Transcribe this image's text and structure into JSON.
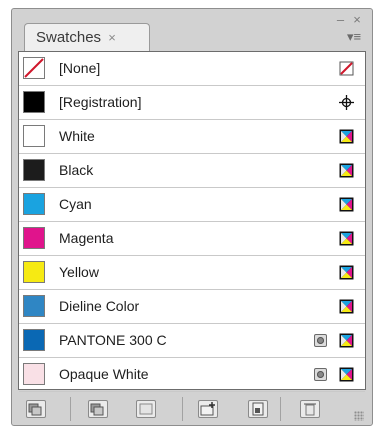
{
  "panel": {
    "tab_label": "Swatches",
    "tab_close_glyph": "×",
    "window_minimize_glyph": "–",
    "window_close_glyph": "×",
    "panel_menu_glyph": "▾≡"
  },
  "swatches": [
    {
      "name": "[None]",
      "color": "none",
      "type_icon": "none-swatch-icon",
      "mode_icon": false
    },
    {
      "name": "[Registration]",
      "color": "#000000",
      "type_icon": "registration-icon",
      "mode_icon": false
    },
    {
      "name": "White",
      "color": "#ffffff",
      "type_icon": "cmyk-process-icon",
      "mode_icon": false
    },
    {
      "name": "Black",
      "color": "#1c1c1c",
      "type_icon": "cmyk-process-icon",
      "mode_icon": false
    },
    {
      "name": "Cyan",
      "color": "#1aa3e0",
      "type_icon": "cmyk-process-icon",
      "mode_icon": false
    },
    {
      "name": "Magenta",
      "color": "#e0148c",
      "type_icon": "cmyk-process-icon",
      "mode_icon": false
    },
    {
      "name": "Yellow",
      "color": "#f6ea13",
      "type_icon": "cmyk-process-icon",
      "mode_icon": false
    },
    {
      "name": "Dieline Color",
      "color": "#2f86c4",
      "type_icon": "cmyk-process-icon",
      "mode_icon": false
    },
    {
      "name": "PANTONE 300 C",
      "color": "#0a68b4",
      "type_icon": "cmyk-process-icon",
      "mode_icon": true
    },
    {
      "name": "Opaque White",
      "color": "#f9e0e6",
      "type_icon": "cmyk-process-icon",
      "mode_icon": true
    }
  ],
  "toolbar": {
    "buttons": [
      {
        "name": "show-all-swatches-button",
        "icon": "swatch-stack-icon"
      },
      {
        "name": "show-color-swatches-button",
        "icon": "color-swatch-stack-icon"
      },
      {
        "name": "show-gradient-swatches-button",
        "icon": "gradient-swatch-icon"
      },
      {
        "name": "new-color-group-button",
        "icon": "folder-plus-icon"
      },
      {
        "name": "new-swatch-button",
        "icon": "new-page-icon"
      },
      {
        "name": "delete-swatch-button",
        "icon": "trash-icon"
      }
    ]
  }
}
